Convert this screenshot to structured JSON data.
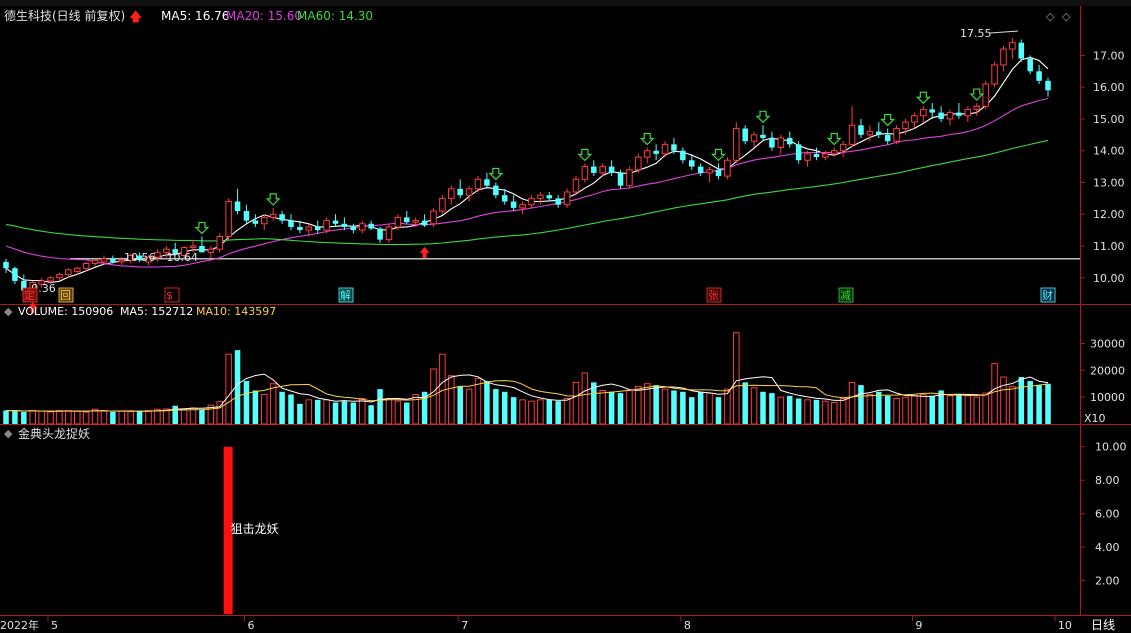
{
  "header": {
    "stock_title": "德生科技(日线 前复权)",
    "ma5": "MA5: 16.76",
    "ma20": "MA20: 15.60",
    "ma60": "MA60: 14.30"
  },
  "volume_panel": {
    "title": "VOLUME: 150906",
    "ma5": "MA5: 152712",
    "ma10": "MA10: 143597",
    "multiplier": "X10"
  },
  "indicator_panel": {
    "title": "金典头龙捉妖",
    "signal_label": "狙击龙妖"
  },
  "annotations": {
    "high_label": "17.55",
    "low_label": "9.36",
    "range_label": "10.56 - 10.64",
    "support_line": 10.6
  },
  "markers": [
    "定",
    "回",
    "$",
    "解",
    "张",
    "减",
    "财"
  ],
  "footer": {
    "year_label": "2022年",
    "months": [
      "5",
      "6",
      "7",
      "8",
      "9",
      "10"
    ],
    "period": "日线"
  },
  "colors": {
    "up": "#ff3c3c",
    "down": "#54ffff",
    "ma5": "#ffffff",
    "ma20": "#e040e0",
    "ma60": "#3cd83c",
    "volume_ma5": "#ffffff",
    "volume_ma10": "#ffd23c",
    "axis": "#b01818",
    "signal_bar": "#ff1010"
  },
  "chart_data": [
    {
      "type": "candlestick",
      "ylim": [
        9.3,
        17.8
      ],
      "y_ticks": [
        10.0,
        11.0,
        12.0,
        13.0,
        14.0,
        15.0,
        16.0,
        17.0
      ],
      "ohlc": [
        [
          10.5,
          10.6,
          10.15,
          10.3
        ],
        [
          10.3,
          10.35,
          9.8,
          9.9
        ],
        [
          9.9,
          10.1,
          9.36,
          9.6
        ],
        [
          9.6,
          9.9,
          9.5,
          9.85
        ],
        [
          9.8,
          10.0,
          9.7,
          9.9
        ],
        [
          9.9,
          10.05,
          9.8,
          10.0
        ],
        [
          10.0,
          10.15,
          9.9,
          10.1
        ],
        [
          10.1,
          10.3,
          10.0,
          10.25
        ],
        [
          10.2,
          10.35,
          10.1,
          10.3
        ],
        [
          10.3,
          10.5,
          10.2,
          10.45
        ],
        [
          10.45,
          10.6,
          10.35,
          10.55
        ],
        [
          10.5,
          10.7,
          10.4,
          10.6
        ],
        [
          10.6,
          10.7,
          10.45,
          10.5
        ],
        [
          10.5,
          10.65,
          10.4,
          10.55
        ],
        [
          10.55,
          10.75,
          10.45,
          10.7
        ],
        [
          10.7,
          10.8,
          10.5,
          10.55
        ],
        [
          10.5,
          10.7,
          10.4,
          10.65
        ],
        [
          10.65,
          10.9,
          10.5,
          10.8
        ],
        [
          10.8,
          11.0,
          10.6,
          10.9
        ],
        [
          10.9,
          11.1,
          10.7,
          10.75
        ],
        [
          10.7,
          11.0,
          10.6,
          10.95
        ],
        [
          10.95,
          11.2,
          10.8,
          11.0
        ],
        [
          11.0,
          11.3,
          10.9,
          10.8
        ],
        [
          10.8,
          11.0,
          10.6,
          10.9
        ],
        [
          10.9,
          11.4,
          10.8,
          11.3
        ],
        [
          11.3,
          12.5,
          11.2,
          12.4
        ],
        [
          12.4,
          12.8,
          12.0,
          12.1
        ],
        [
          12.1,
          12.3,
          11.7,
          11.8
        ],
        [
          11.8,
          12.0,
          11.6,
          11.7
        ],
        [
          11.7,
          12.0,
          11.5,
          11.9
        ],
        [
          11.9,
          12.2,
          11.8,
          12.0
        ],
        [
          12.0,
          12.1,
          11.7,
          11.8
        ],
        [
          11.8,
          12.0,
          11.5,
          11.6
        ],
        [
          11.6,
          11.8,
          11.4,
          11.5
        ],
        [
          11.5,
          11.7,
          11.3,
          11.6
        ],
        [
          11.6,
          11.8,
          11.4,
          11.5
        ],
        [
          11.5,
          11.9,
          11.4,
          11.8
        ],
        [
          11.8,
          12.0,
          11.6,
          11.7
        ],
        [
          11.7,
          11.9,
          11.5,
          11.6
        ],
        [
          11.6,
          11.7,
          11.4,
          11.5
        ],
        [
          11.5,
          11.8,
          11.4,
          11.7
        ],
        [
          11.7,
          11.8,
          11.5,
          11.55
        ],
        [
          11.55,
          11.6,
          11.1,
          11.2
        ],
        [
          11.2,
          11.7,
          11.1,
          11.6
        ],
        [
          11.6,
          12.0,
          11.5,
          11.9
        ],
        [
          11.9,
          12.1,
          11.7,
          11.75
        ],
        [
          11.75,
          11.9,
          11.6,
          11.8
        ],
        [
          11.8,
          12.0,
          11.6,
          11.65
        ],
        [
          11.7,
          12.2,
          11.6,
          12.1
        ],
        [
          12.1,
          12.6,
          12.0,
          12.5
        ],
        [
          12.5,
          12.9,
          12.3,
          12.8
        ],
        [
          12.8,
          13.1,
          12.5,
          12.6
        ],
        [
          12.6,
          12.9,
          12.4,
          12.8
        ],
        [
          12.8,
          13.2,
          12.7,
          13.1
        ],
        [
          13.1,
          13.3,
          12.8,
          12.9
        ],
        [
          12.9,
          13.0,
          12.5,
          12.6
        ],
        [
          12.6,
          12.8,
          12.3,
          12.4
        ],
        [
          12.4,
          12.6,
          12.1,
          12.2
        ],
        [
          12.2,
          12.4,
          12.0,
          12.3
        ],
        [
          12.3,
          12.6,
          12.2,
          12.5
        ],
        [
          12.5,
          12.7,
          12.3,
          12.6
        ],
        [
          12.6,
          12.7,
          12.4,
          12.5
        ],
        [
          12.5,
          12.6,
          12.2,
          12.3
        ],
        [
          12.3,
          12.8,
          12.2,
          12.7
        ],
        [
          12.7,
          13.2,
          12.6,
          13.1
        ],
        [
          13.1,
          13.6,
          13.0,
          13.5
        ],
        [
          13.5,
          13.7,
          13.2,
          13.3
        ],
        [
          13.3,
          13.6,
          13.2,
          13.5
        ],
        [
          13.5,
          13.7,
          13.2,
          13.3
        ],
        [
          13.3,
          13.4,
          12.8,
          12.9
        ],
        [
          12.9,
          13.5,
          12.8,
          13.4
        ],
        [
          13.4,
          13.9,
          13.3,
          13.8
        ],
        [
          13.8,
          14.1,
          13.6,
          14.0
        ],
        [
          14.0,
          14.2,
          13.7,
          13.9
        ],
        [
          13.9,
          14.3,
          13.8,
          14.2
        ],
        [
          14.2,
          14.4,
          13.9,
          14.0
        ],
        [
          14.0,
          14.1,
          13.6,
          13.7
        ],
        [
          13.7,
          13.9,
          13.4,
          13.5
        ],
        [
          13.5,
          13.6,
          13.2,
          13.3
        ],
        [
          13.3,
          13.5,
          13.0,
          13.4
        ],
        [
          13.4,
          13.6,
          13.1,
          13.2
        ],
        [
          13.2,
          13.8,
          13.1,
          13.7
        ],
        [
          13.7,
          14.9,
          13.6,
          14.7
        ],
        [
          14.7,
          14.8,
          14.2,
          14.3
        ],
        [
          14.3,
          14.6,
          14.1,
          14.5
        ],
        [
          14.5,
          14.8,
          14.3,
          14.4
        ],
        [
          14.4,
          14.6,
          14.0,
          14.1
        ],
        [
          14.1,
          14.5,
          13.9,
          14.4
        ],
        [
          14.4,
          14.6,
          14.1,
          14.2
        ],
        [
          14.2,
          14.3,
          13.6,
          13.7
        ],
        [
          13.7,
          14.0,
          13.5,
          13.9
        ],
        [
          13.9,
          14.1,
          13.7,
          13.8
        ],
        [
          13.8,
          14.0,
          13.7,
          13.9
        ],
        [
          13.9,
          14.1,
          13.8,
          14.0
        ],
        [
          14.0,
          14.3,
          13.8,
          14.2
        ],
        [
          14.2,
          15.4,
          14.1,
          14.8
        ],
        [
          14.8,
          15.0,
          14.4,
          14.5
        ],
        [
          14.5,
          14.8,
          14.3,
          14.6
        ],
        [
          14.6,
          14.9,
          14.4,
          14.5
        ],
        [
          14.5,
          14.7,
          14.2,
          14.3
        ],
        [
          14.3,
          14.8,
          14.2,
          14.7
        ],
        [
          14.7,
          15.0,
          14.5,
          14.9
        ],
        [
          14.9,
          15.2,
          14.7,
          15.1
        ],
        [
          15.1,
          15.4,
          14.9,
          15.3
        ],
        [
          15.3,
          15.5,
          15.0,
          15.2
        ],
        [
          15.2,
          15.4,
          14.9,
          15.0
        ],
        [
          15.0,
          15.3,
          14.8,
          15.2
        ],
        [
          15.2,
          15.5,
          15.0,
          15.1
        ],
        [
          15.1,
          15.4,
          14.9,
          15.3
        ],
        [
          15.3,
          15.5,
          15.1,
          15.4
        ],
        [
          15.4,
          16.2,
          15.3,
          16.1
        ],
        [
          16.1,
          16.8,
          16.0,
          16.7
        ],
        [
          16.7,
          17.3,
          16.5,
          17.2
        ],
        [
          17.2,
          17.55,
          16.9,
          17.4
        ],
        [
          17.4,
          17.5,
          16.8,
          16.9
        ],
        [
          16.9,
          17.0,
          16.4,
          16.5
        ],
        [
          16.5,
          16.7,
          16.1,
          16.2
        ],
        [
          16.2,
          16.3,
          15.7,
          15.9
        ]
      ]
    },
    {
      "type": "bar",
      "ylim": [
        0,
        38000
      ],
      "y_ticks": [
        10000,
        20000,
        30000
      ],
      "values": [
        5000,
        5000,
        4500,
        5000,
        4800,
        4500,
        5000,
        5000,
        4700,
        4400,
        5500,
        5000,
        4500,
        4800,
        4600,
        4700,
        5000,
        5500,
        5600,
        6800,
        5500,
        6000,
        5300,
        7000,
        8300,
        26000,
        27500,
        16000,
        12500,
        11000,
        15000,
        12000,
        11000,
        7500,
        9000,
        9000,
        9000,
        8000,
        8500,
        8000,
        9500,
        7000,
        13000,
        9500,
        8500,
        8000,
        11000,
        12000,
        20500,
        26000,
        18000,
        14000,
        13000,
        17000,
        16000,
        13000,
        12000,
        10000,
        9000,
        8500,
        9000,
        9000,
        8500,
        9500,
        15500,
        19000,
        15500,
        12500,
        12000,
        11500,
        12500,
        14000,
        15000,
        14500,
        13000,
        12500,
        12000,
        10000,
        12000,
        11500,
        10000,
        13000,
        34000,
        15500,
        13500,
        12000,
        11500,
        10000,
        10500,
        9500,
        9000,
        9000,
        8500,
        8000,
        9500,
        15500,
        14500,
        11000,
        12000,
        10500,
        9500,
        10000,
        10500,
        11000,
        10500,
        12500,
        10500,
        11000,
        10500,
        10000,
        11500,
        22500,
        17500,
        14000,
        17500,
        16000,
        14500,
        15000
      ]
    },
    {
      "type": "bar",
      "ylim": [
        0,
        11
      ],
      "y_ticks": [
        2.0,
        4.0,
        6.0,
        8.0,
        10.0
      ],
      "signal_index": 25,
      "signal_value": 10.0
    }
  ]
}
